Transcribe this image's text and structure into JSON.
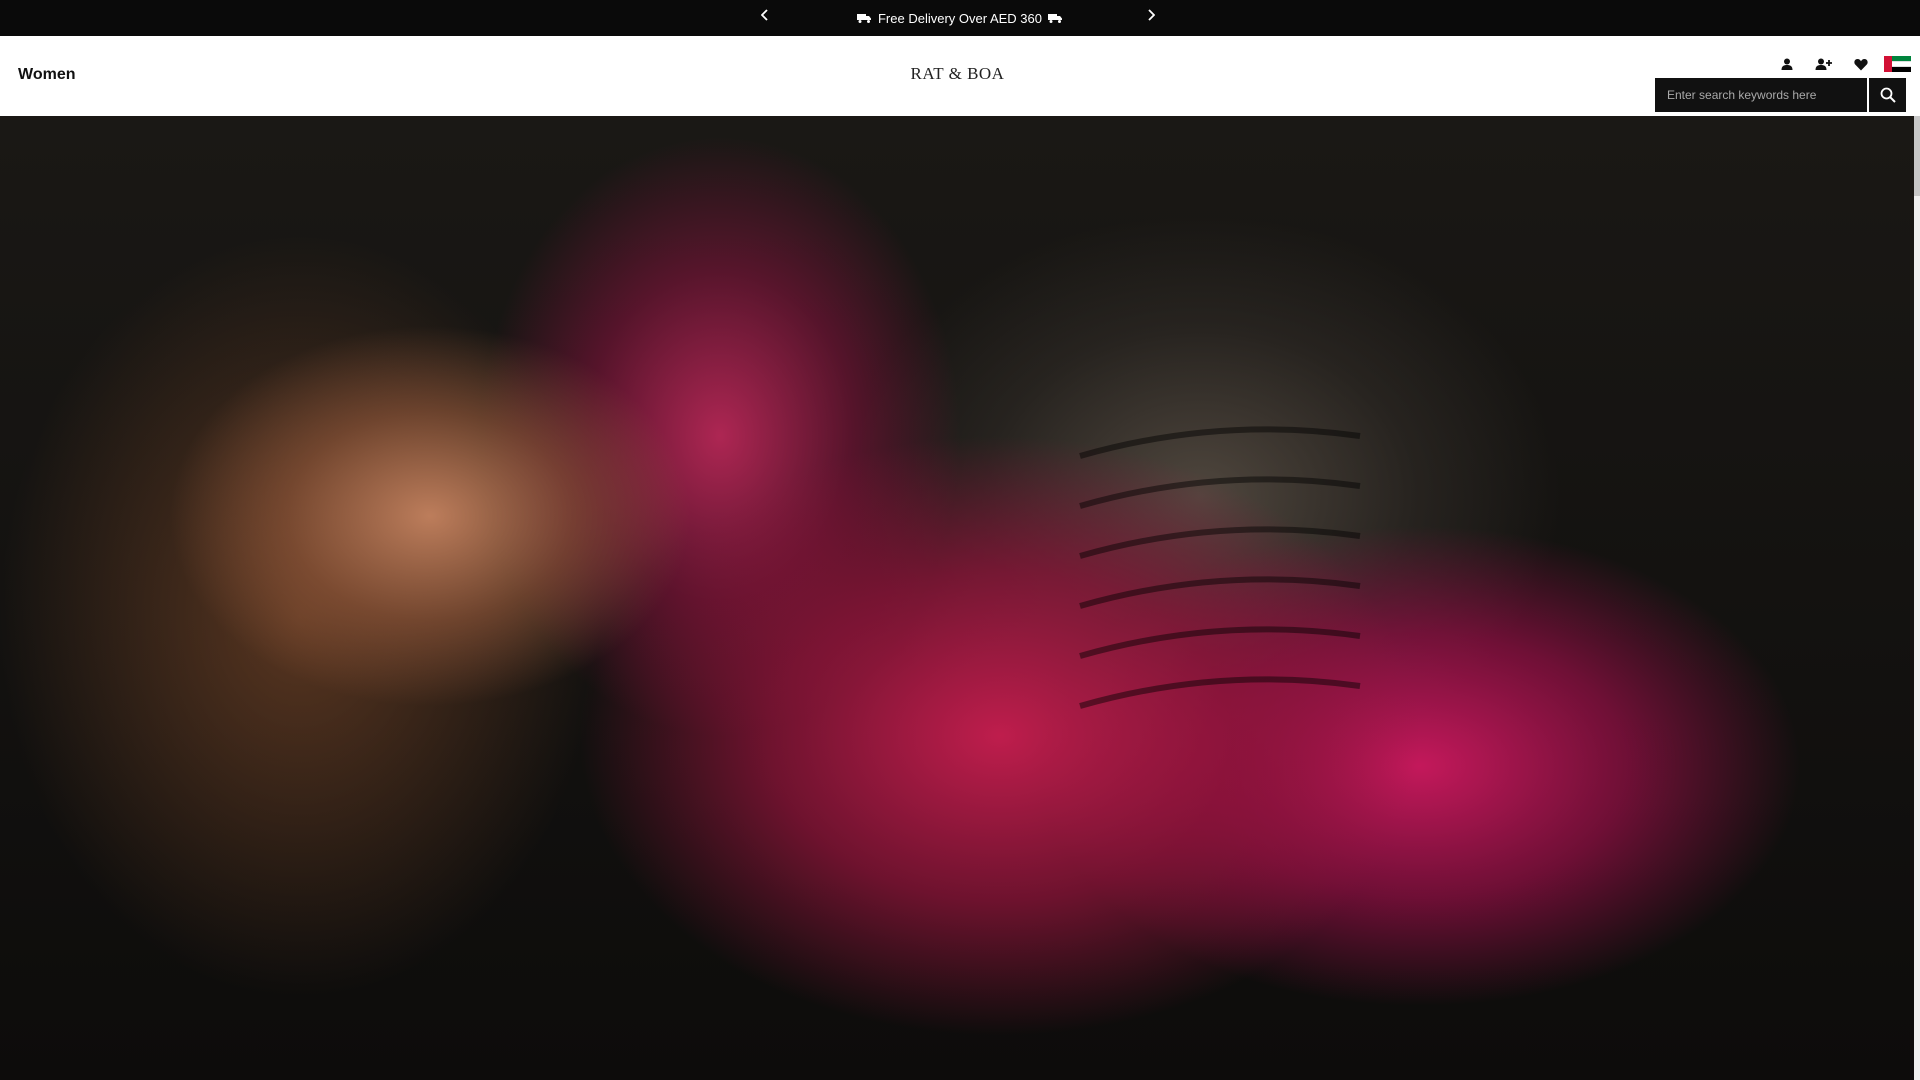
{
  "announcement": {
    "message": "Free Delivery Over AED 360",
    "prev_icon": "chevron-left-icon",
    "next_icon": "chevron-right-icon"
  },
  "header": {
    "nav_label": "Women",
    "logo_text": "RAT & BOA",
    "icons": [
      "account-icon",
      "register-icon",
      "wishlist-heart-icon",
      "uae-flag-icon"
    ],
    "search": {
      "placeholder": "Enter search keywords here",
      "button_icon": "search-icon"
    }
  },
  "hero": {
    "description_icon": "hero-image"
  },
  "colors": {
    "topbar_bg": "#0a0a0a",
    "header_bg": "#ffffff",
    "search_bg": "#111111"
  }
}
